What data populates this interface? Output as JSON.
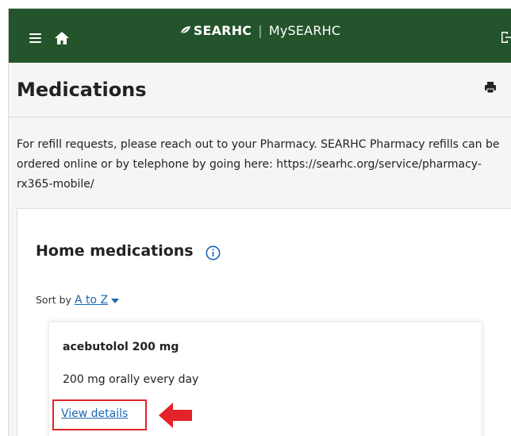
{
  "header": {
    "logo_text": "SEARHC",
    "app_name": "MySEARHC",
    "separator": "|",
    "icons": [
      "menu-icon",
      "home-icon",
      "leaf-logo-icon",
      "sign-out-icon"
    ],
    "bar_color": "#24542b"
  },
  "page": {
    "title": "Medications",
    "print_icon": "print-icon",
    "intro_text": "For refill requests, please reach out to your Pharmacy. SEARHC Pharmacy refills can be ordered online or by telephone by going here: https://searhc.org/service/pharmacy-rx365-mobile/"
  },
  "home_medications": {
    "title": "Home medications",
    "info_icon": "info-icon",
    "sort_label": "Sort by",
    "sort_value": "A to Z",
    "items": [
      {
        "name": "acebutolol 200 mg",
        "instructions": "200 mg orally every day",
        "link": "View details"
      }
    ]
  },
  "annotation": {
    "highlight_color": "#e3232a",
    "arrow_icon": "left-arrow-icon"
  }
}
